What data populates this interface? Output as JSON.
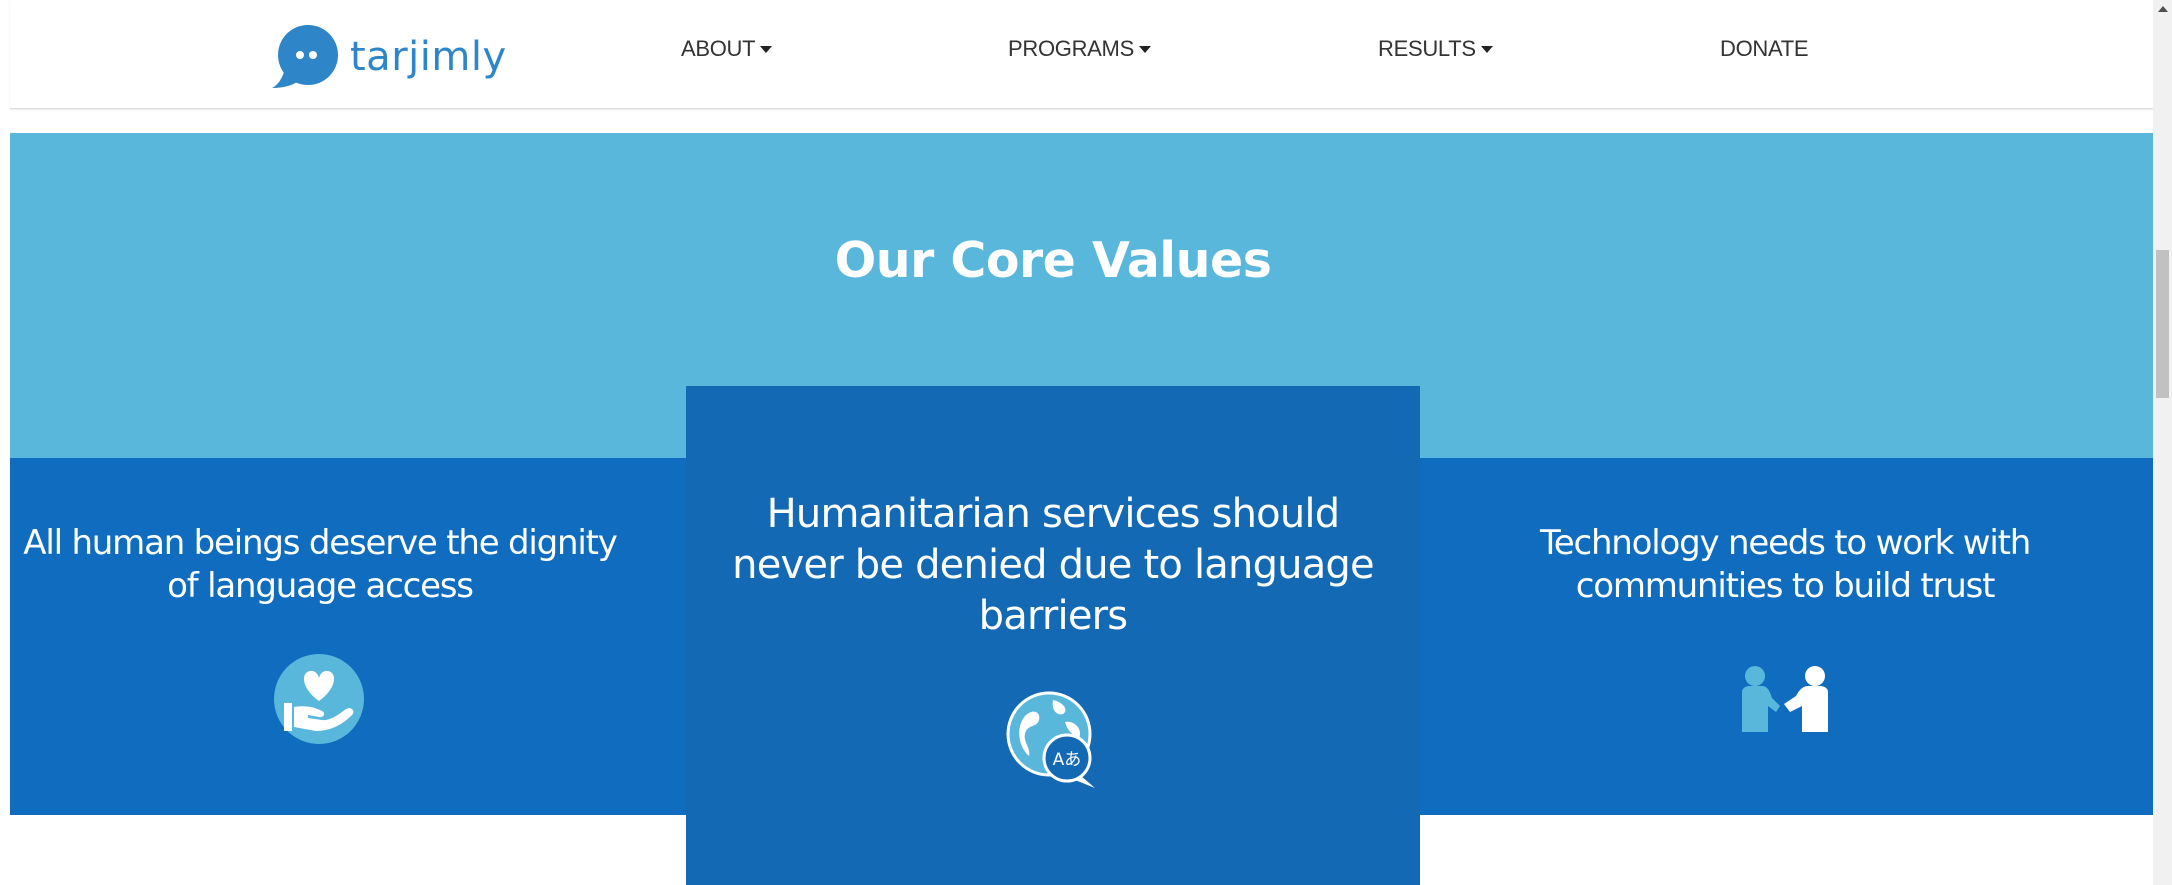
{
  "brand": {
    "name": "tarjimly"
  },
  "nav": {
    "items": [
      {
        "label": "ABOUT",
        "has_dropdown": true
      },
      {
        "label": "PROGRAMS",
        "has_dropdown": true
      },
      {
        "label": "RESULTS",
        "has_dropdown": true
      },
      {
        "label": "DONATE",
        "has_dropdown": false
      }
    ]
  },
  "core_values": {
    "title": "Our Core Values",
    "items": [
      {
        "text": "All human beings deserve the dignity of language access",
        "icon": "heart-hand-icon"
      },
      {
        "text": "Humanitarian services should never be denied due to language barriers",
        "icon": "globe-translate-icon"
      },
      {
        "text": "Technology needs to work with communities to build trust",
        "icon": "handshake-icon"
      }
    ]
  },
  "colors": {
    "brand": "#2e86c9",
    "section_light": "#58b7db",
    "section_dark": "#0f6cbf",
    "card_center": "#1469b5",
    "text_on_blue": "#ffffff"
  }
}
